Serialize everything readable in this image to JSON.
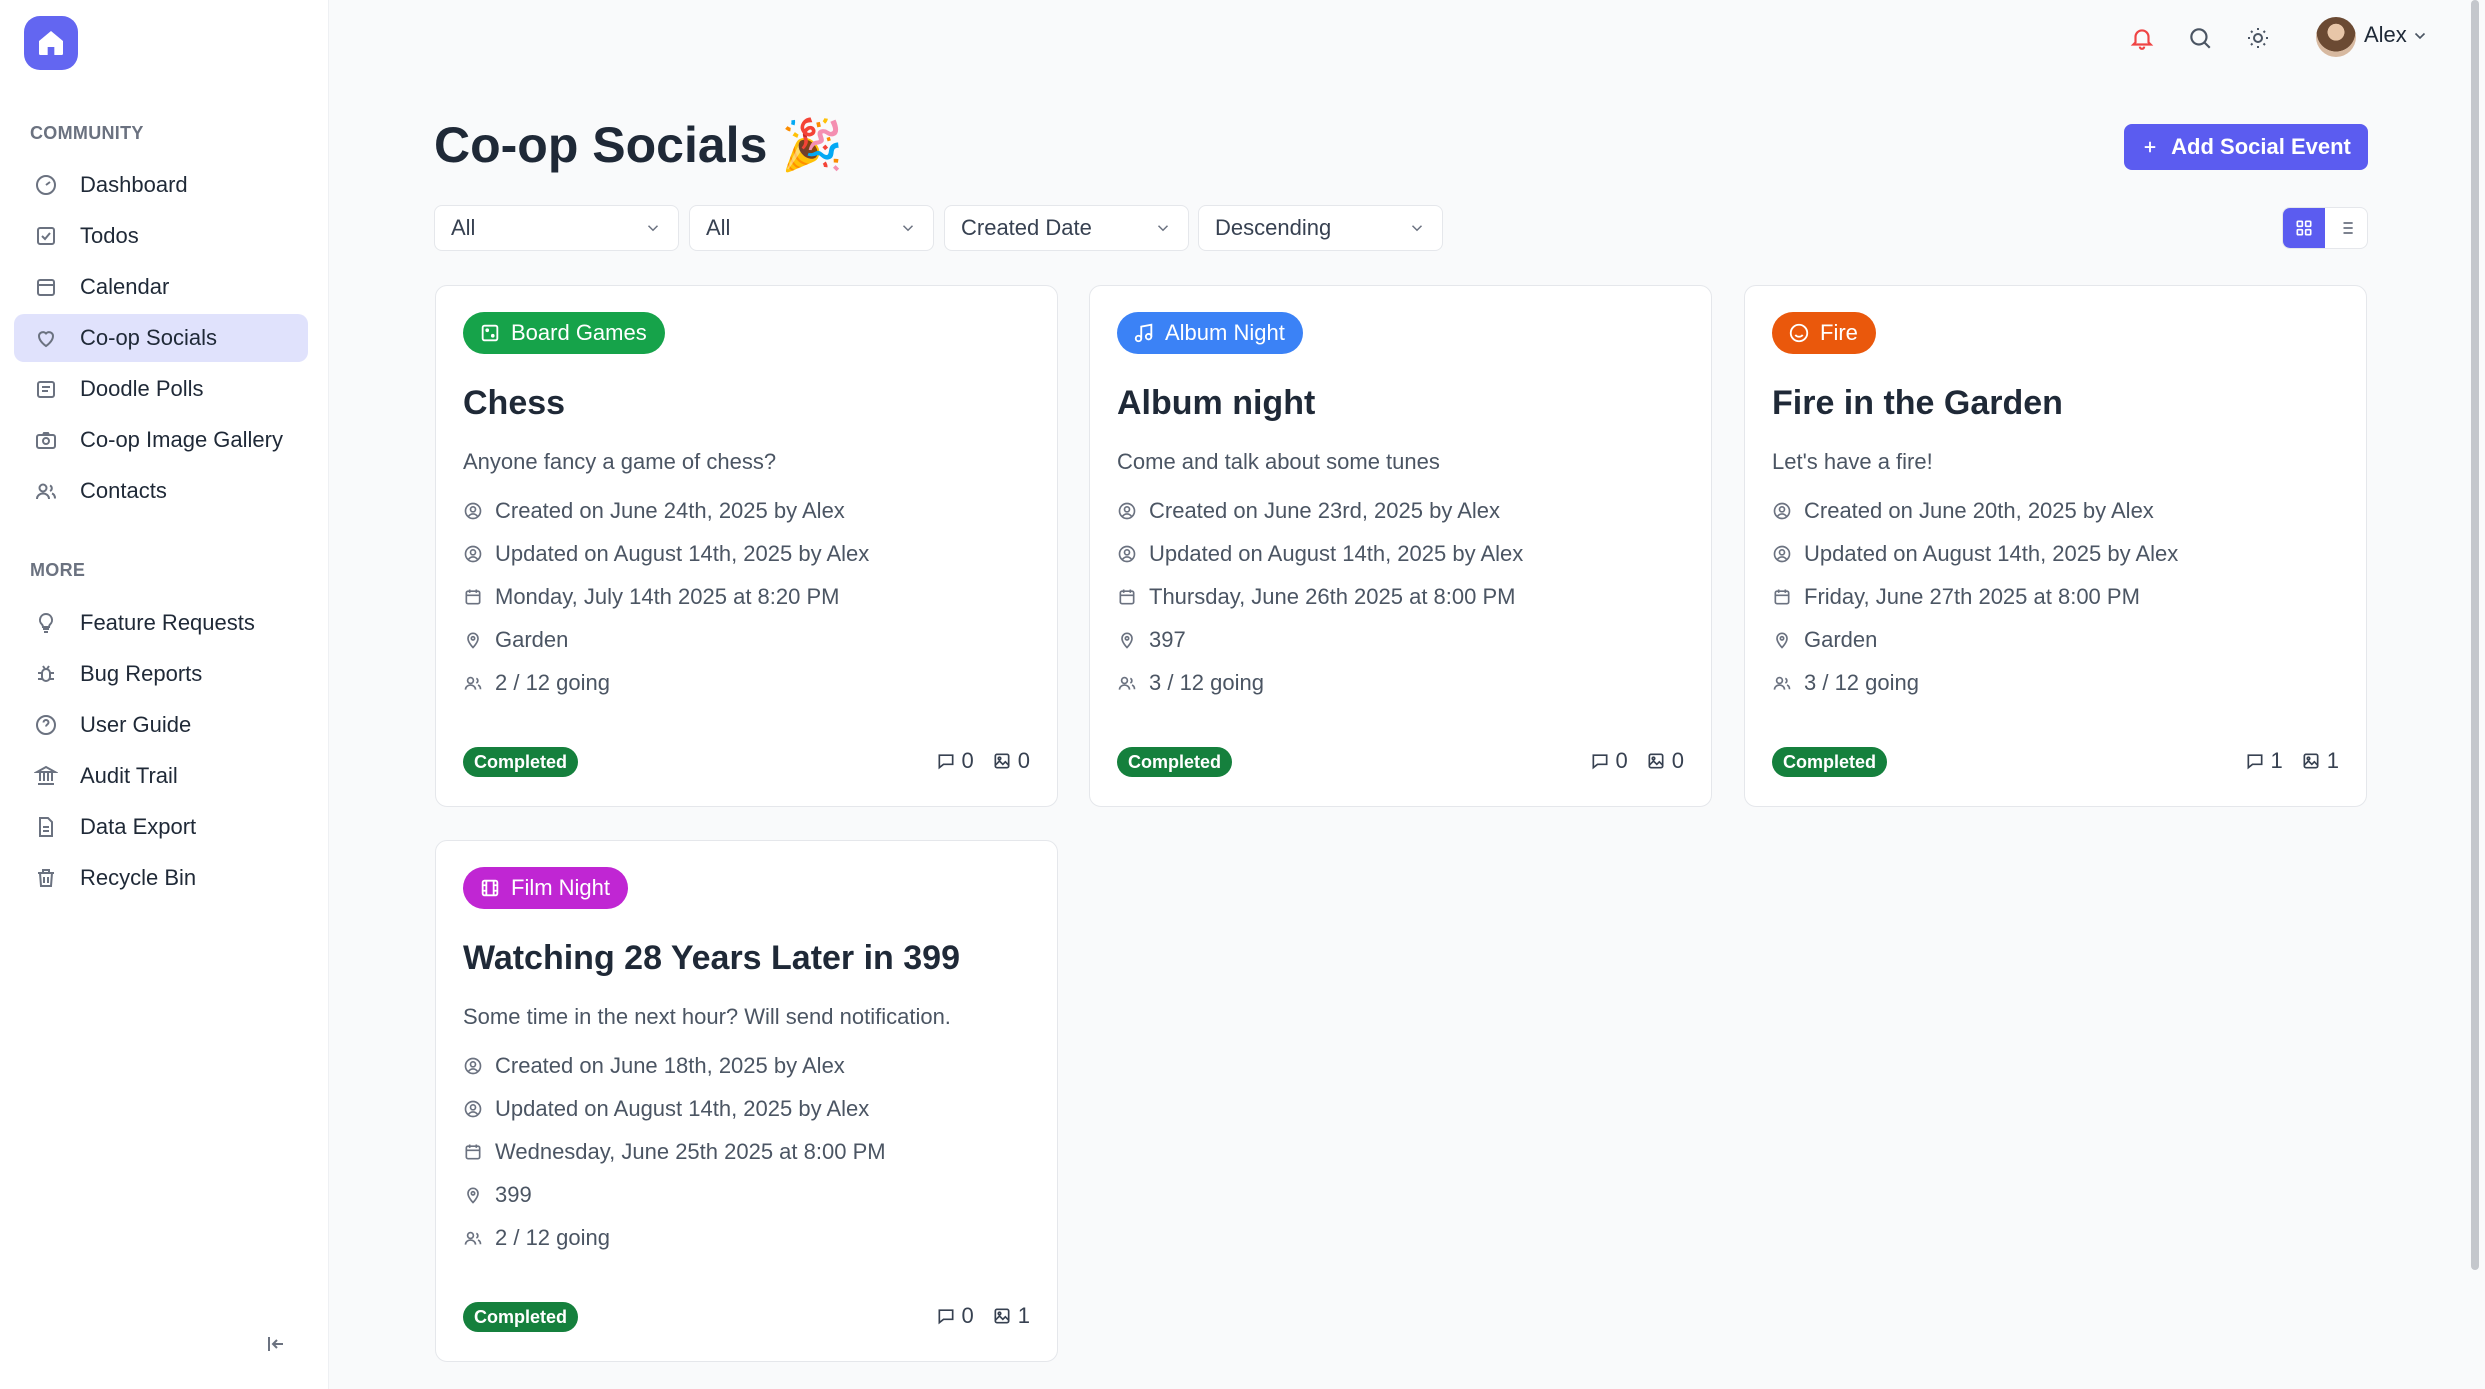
{
  "sidebar": {
    "community_label": "COMMUNITY",
    "more_label": "MORE",
    "community_items": [
      {
        "label": "Dashboard",
        "icon": "dashboard-icon"
      },
      {
        "label": "Todos",
        "icon": "todo-checkbox-icon"
      },
      {
        "label": "Calendar",
        "icon": "calendar-icon"
      },
      {
        "label": "Co-op Socials",
        "icon": "heart-icon",
        "active": true
      },
      {
        "label": "Doodle Polls",
        "icon": "poll-icon"
      },
      {
        "label": "Co-op Image Gallery",
        "icon": "camera-icon"
      },
      {
        "label": "Contacts",
        "icon": "users-icon"
      }
    ],
    "more_items": [
      {
        "label": "Feature Requests",
        "icon": "lightbulb-icon"
      },
      {
        "label": "Bug Reports",
        "icon": "bug-icon"
      },
      {
        "label": "User Guide",
        "icon": "help-circle-icon"
      },
      {
        "label": "Audit Trail",
        "icon": "audit-icon"
      },
      {
        "label": "Data Export",
        "icon": "file-export-icon"
      },
      {
        "label": "Recycle Bin",
        "icon": "trash-icon"
      }
    ]
  },
  "topbar": {
    "user_name": "Alex"
  },
  "header": {
    "title": "Co-op Socials 🎉",
    "add_button": "Add Social Event"
  },
  "filters": {
    "filter1": "All",
    "filter2": "All",
    "sort_by": "Created Date",
    "sort_order": "Descending"
  },
  "colors": {
    "accent": "#5b5cf0",
    "board_games": "#16a34a",
    "album_night": "#3b82f6",
    "fire": "#ea580c",
    "film_night": "#c026d3",
    "completed": "#15803d"
  },
  "events": [
    {
      "tag": "Board Games",
      "tag_icon": "dice-icon",
      "title": "Chess",
      "description": "Anyone fancy a game of chess?",
      "created": "Created on June 24th, 2025 by Alex",
      "updated": "Updated on August 14th, 2025 by Alex",
      "date": "Monday, July 14th 2025 at 8:20 PM",
      "location": "Garden",
      "going": "2 / 12 going",
      "status": "Completed",
      "comments": "0",
      "images": "0"
    },
    {
      "tag": "Album Night",
      "tag_icon": "music-note-icon",
      "title": "Album night",
      "description": "Come and talk about some tunes",
      "created": "Created on June 23rd, 2025 by Alex",
      "updated": "Updated on August 14th, 2025 by Alex",
      "date": "Thursday, June 26th 2025 at 8:00 PM",
      "location": "397",
      "going": "3 / 12 going",
      "status": "Completed",
      "comments": "0",
      "images": "0"
    },
    {
      "tag": "Fire",
      "tag_icon": "smile-icon",
      "title": "Fire in the Garden",
      "description": "Let's have a fire!",
      "created": "Created on June 20th, 2025 by Alex",
      "updated": "Updated on August 14th, 2025 by Alex",
      "date": "Friday, June 27th 2025 at 8:00 PM",
      "location": "Garden",
      "going": "3 / 12 going",
      "status": "Completed",
      "comments": "1",
      "images": "1"
    },
    {
      "tag": "Film Night",
      "tag_icon": "film-icon",
      "title": "Watching 28 Years Later in 399",
      "description": "Some time in the next hour? Will send notification.",
      "created": "Created on June 18th, 2025 by Alex",
      "updated": "Updated on August 14th, 2025 by Alex",
      "date": "Wednesday, June 25th 2025 at 8:00 PM",
      "location": "399",
      "going": "2 / 12 going",
      "status": "Completed",
      "comments": "0",
      "images": "1"
    }
  ]
}
